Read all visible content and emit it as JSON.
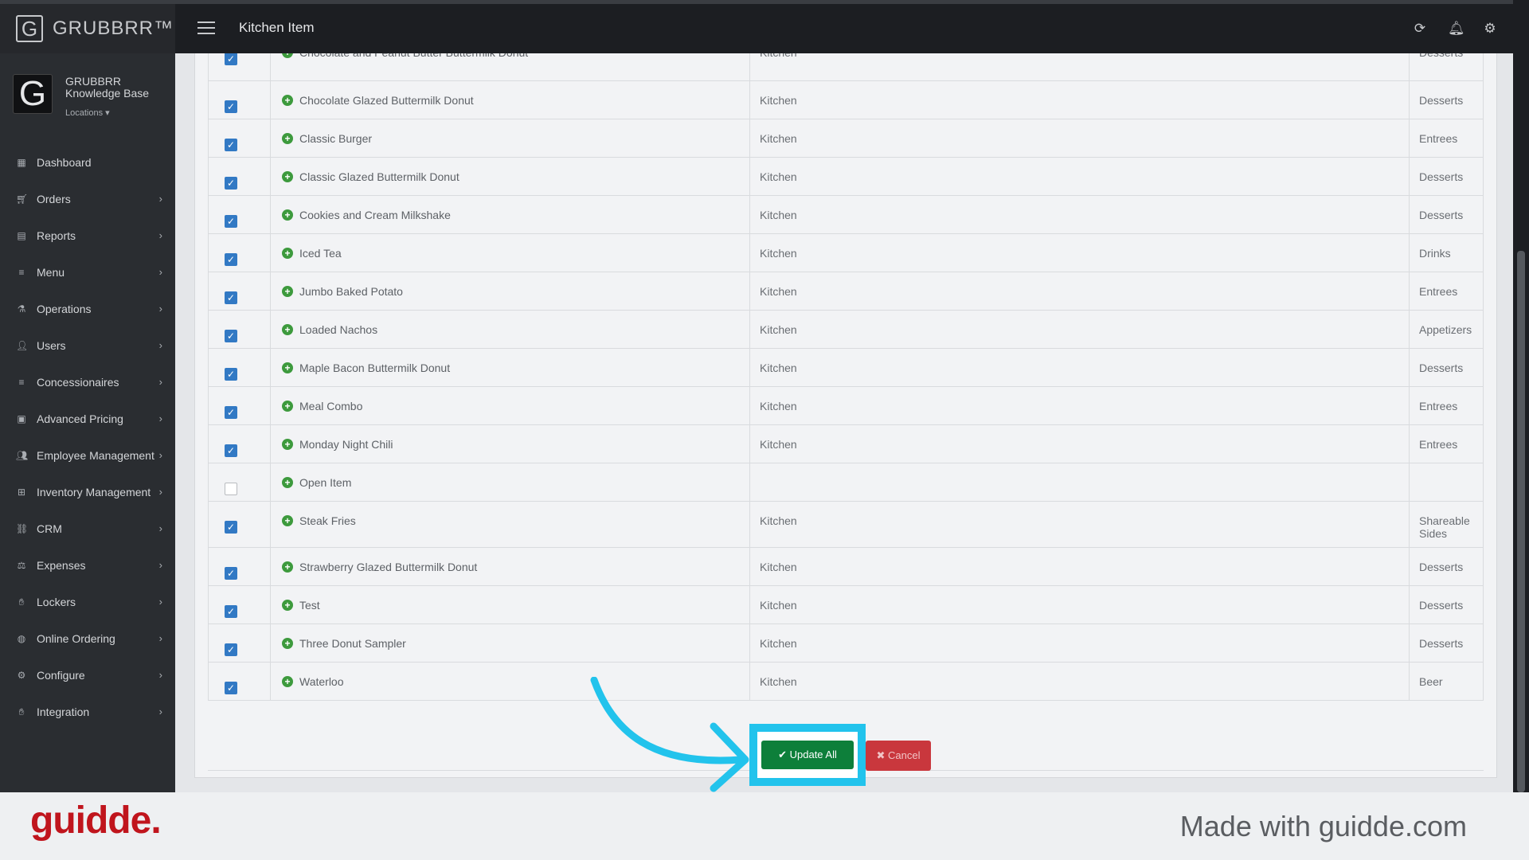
{
  "app": {
    "brand": "GRUBBRR™",
    "page_title": "Kitchen Item"
  },
  "profile": {
    "name": "GRUBBRR Knowledge Base",
    "locations_label": "Locations ▾"
  },
  "sidebar": {
    "items": [
      {
        "label": "Dashboard",
        "icon": "dashboard-icon",
        "has_chevron": false
      },
      {
        "label": "Orders",
        "icon": "cart-icon",
        "has_chevron": true
      },
      {
        "label": "Reports",
        "icon": "reports-icon",
        "has_chevron": true
      },
      {
        "label": "Menu",
        "icon": "menu-icon",
        "has_chevron": true
      },
      {
        "label": "Operations",
        "icon": "flask-icon",
        "has_chevron": true
      },
      {
        "label": "Users",
        "icon": "user-icon",
        "has_chevron": true
      },
      {
        "label": "Concessionaires",
        "icon": "list-icon",
        "has_chevron": true
      },
      {
        "label": "Advanced Pricing",
        "icon": "money-icon",
        "has_chevron": true
      },
      {
        "label": "Employee Management",
        "icon": "group-icon",
        "has_chevron": true
      },
      {
        "label": "Inventory Management",
        "icon": "sitemap-icon",
        "has_chevron": true
      },
      {
        "label": "CRM",
        "icon": "link-icon",
        "has_chevron": true
      },
      {
        "label": "Expenses",
        "icon": "scale-icon",
        "has_chevron": true
      },
      {
        "label": "Lockers",
        "icon": "lockers-icon",
        "has_chevron": true
      },
      {
        "label": "Online Ordering",
        "icon": "globe-icon",
        "has_chevron": true
      },
      {
        "label": "Configure",
        "icon": "gear-icon",
        "has_chevron": true
      },
      {
        "label": "Integration",
        "icon": "integration-icon",
        "has_chevron": true
      }
    ]
  },
  "table": {
    "rows": [
      {
        "name": "Chocolate and Peanut Butter Buttermilk Donut",
        "station": "Kitchen",
        "category": "Desserts",
        "checked": true
      },
      {
        "name": "Chocolate Glazed Buttermilk Donut",
        "station": "Kitchen",
        "category": "Desserts",
        "checked": true
      },
      {
        "name": "Classic Burger",
        "station": "Kitchen",
        "category": "Entrees",
        "checked": true
      },
      {
        "name": "Classic Glazed Buttermilk Donut",
        "station": "Kitchen",
        "category": "Desserts",
        "checked": true
      },
      {
        "name": "Cookies and Cream Milkshake",
        "station": "Kitchen",
        "category": "Desserts",
        "checked": true
      },
      {
        "name": "Iced Tea",
        "station": "Kitchen",
        "category": "Drinks",
        "checked": true
      },
      {
        "name": "Jumbo Baked Potato",
        "station": "Kitchen",
        "category": "Entrees",
        "checked": true
      },
      {
        "name": "Loaded Nachos",
        "station": "Kitchen",
        "category": "Appetizers",
        "checked": true
      },
      {
        "name": "Maple Bacon Buttermilk Donut",
        "station": "Kitchen",
        "category": "Desserts",
        "checked": true
      },
      {
        "name": "Meal Combo",
        "station": "Kitchen",
        "category": "Entrees",
        "checked": true
      },
      {
        "name": "Monday Night Chili",
        "station": "Kitchen",
        "category": "Entrees",
        "checked": true
      },
      {
        "name": "Open Item",
        "station": "",
        "category": "",
        "checked": false
      },
      {
        "name": "Steak Fries",
        "station": "Kitchen",
        "category": "Shareable Sides",
        "checked": true
      },
      {
        "name": "Strawberry Glazed Buttermilk Donut",
        "station": "Kitchen",
        "category": "Desserts",
        "checked": true
      },
      {
        "name": "Test",
        "station": "Kitchen",
        "category": "Desserts",
        "checked": true
      },
      {
        "name": "Three Donut Sampler",
        "station": "Kitchen",
        "category": "Desserts",
        "checked": true
      },
      {
        "name": "Waterloo",
        "station": "Kitchen",
        "category": "Beer",
        "checked": true
      }
    ]
  },
  "actions": {
    "update_label": "✔ Update All",
    "cancel_label": "✖ Cancel"
  },
  "footer": {
    "logo": "guidde.",
    "made_with": "Made with guidde.com"
  },
  "colors": {
    "highlight": "#22c3ec",
    "update_button": "#0d7f3a",
    "cancel_button": "#c9373d",
    "checkbox": "#3279c4",
    "guidde_red": "#c0151d"
  }
}
